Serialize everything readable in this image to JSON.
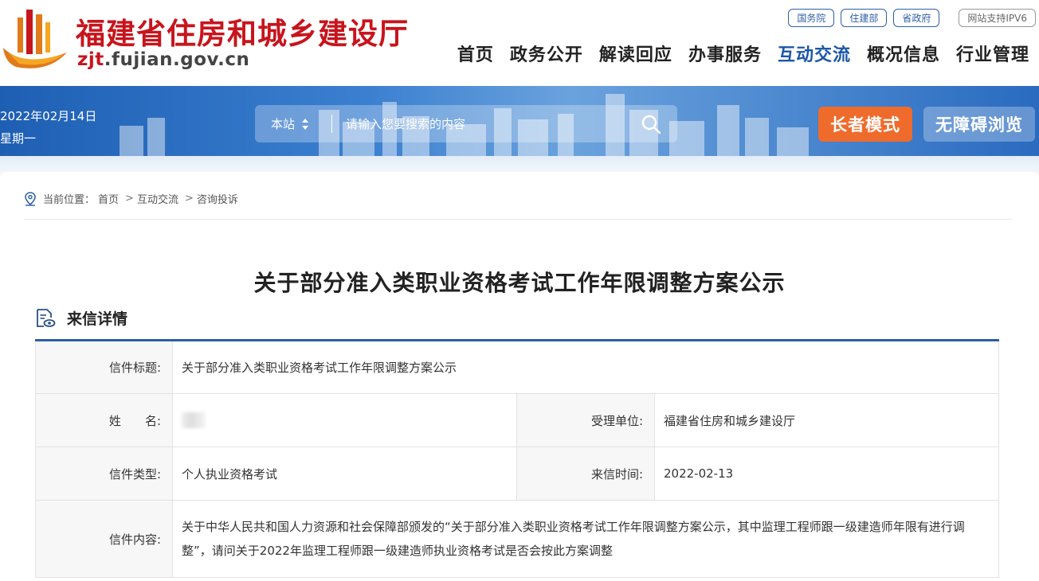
{
  "header": {
    "site_title": "福建省住房和城乡建设厅",
    "domain_prefix": "zjt",
    "domain_rest": ".fujian.gov.cn",
    "top_links": [
      "国务院",
      "住建部",
      "省政府"
    ],
    "ipv6_label": "网站支持IPV6",
    "nav": [
      "首页",
      "政务公开",
      "解读回应",
      "办事服务",
      "互动交流",
      "概况信息",
      "行业管理"
    ],
    "active_nav": "互动交流"
  },
  "banner": {
    "date": "2022年02月14日",
    "weekday": "星期一",
    "search_scope": "本站",
    "search_placeholder": "请输入您要搜索的内容",
    "elder_mode": "长者模式",
    "accessible": "无障碍浏览"
  },
  "breadcrumb": {
    "prefix": "当前位置：",
    "items": [
      "首页",
      "互动交流",
      "咨询投诉"
    ],
    "separator": ">"
  },
  "article": {
    "title": "关于部分准入类职业资格考试工作年限调整方案公示",
    "section_title": "来信详情"
  },
  "details": {
    "letter_title_label": "信件标题:",
    "letter_title_value": "关于部分准入类职业资格考试工作年限调整方案公示",
    "name_label_1": "姓",
    "name_label_2": "名:",
    "dept_label": "受理单位:",
    "dept_value": "福建省住房和城乡建设厅",
    "type_label": "信件类型:",
    "type_value": "个人执业资格考试",
    "time_label": "来信时间:",
    "time_value": "2022-02-13",
    "content_label": "信件内容:",
    "content_value": "关于中华人民共和国人力资源和社会保障部颁发的“关于部分准入类职业资格考试工作年限调整方案公示，其中监理工程师跟一级建造师年限有进行调整”，请问关于2022年监理工程师跟一级建造师执业资格考试是否会按此方案调整"
  },
  "colors": {
    "brand_red": "#c8141c",
    "nav_active": "#1b57a7",
    "elder_orange": "#ef6b2b",
    "table_accent": "#2a5fa5"
  },
  "icons": [
    "logo-mark-icon",
    "updown-arrow-icon",
    "search-icon",
    "location-icon",
    "document-view-icon"
  ]
}
